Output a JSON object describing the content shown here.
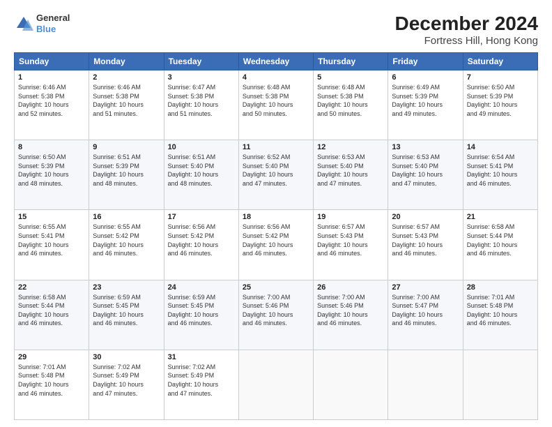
{
  "header": {
    "logo": {
      "line1": "General",
      "line2": "Blue"
    },
    "title": "December 2024",
    "subtitle": "Fortress Hill, Hong Kong"
  },
  "calendar": {
    "days_of_week": [
      "Sunday",
      "Monday",
      "Tuesday",
      "Wednesday",
      "Thursday",
      "Friday",
      "Saturday"
    ],
    "weeks": [
      [
        {
          "day": "",
          "info": ""
        },
        {
          "day": "2",
          "info": "Sunrise: 6:46 AM\nSunset: 5:38 PM\nDaylight: 10 hours\nand 51 minutes."
        },
        {
          "day": "3",
          "info": "Sunrise: 6:47 AM\nSunset: 5:38 PM\nDaylight: 10 hours\nand 51 minutes."
        },
        {
          "day": "4",
          "info": "Sunrise: 6:48 AM\nSunset: 5:38 PM\nDaylight: 10 hours\nand 50 minutes."
        },
        {
          "day": "5",
          "info": "Sunrise: 6:48 AM\nSunset: 5:38 PM\nDaylight: 10 hours\nand 50 minutes."
        },
        {
          "day": "6",
          "info": "Sunrise: 6:49 AM\nSunset: 5:39 PM\nDaylight: 10 hours\nand 49 minutes."
        },
        {
          "day": "7",
          "info": "Sunrise: 6:50 AM\nSunset: 5:39 PM\nDaylight: 10 hours\nand 49 minutes."
        }
      ],
      [
        {
          "day": "1",
          "info": "Sunrise: 6:46 AM\nSunset: 5:38 PM\nDaylight: 10 hours\nand 52 minutes."
        },
        {
          "day": "",
          "info": ""
        },
        {
          "day": "",
          "info": ""
        },
        {
          "day": "",
          "info": ""
        },
        {
          "day": "",
          "info": ""
        },
        {
          "day": "",
          "info": ""
        },
        {
          "day": "",
          "info": ""
        }
      ],
      [
        {
          "day": "8",
          "info": "Sunrise: 6:50 AM\nSunset: 5:39 PM\nDaylight: 10 hours\nand 48 minutes."
        },
        {
          "day": "9",
          "info": "Sunrise: 6:51 AM\nSunset: 5:39 PM\nDaylight: 10 hours\nand 48 minutes."
        },
        {
          "day": "10",
          "info": "Sunrise: 6:51 AM\nSunset: 5:40 PM\nDaylight: 10 hours\nand 48 minutes."
        },
        {
          "day": "11",
          "info": "Sunrise: 6:52 AM\nSunset: 5:40 PM\nDaylight: 10 hours\nand 47 minutes."
        },
        {
          "day": "12",
          "info": "Sunrise: 6:53 AM\nSunset: 5:40 PM\nDaylight: 10 hours\nand 47 minutes."
        },
        {
          "day": "13",
          "info": "Sunrise: 6:53 AM\nSunset: 5:40 PM\nDaylight: 10 hours\nand 47 minutes."
        },
        {
          "day": "14",
          "info": "Sunrise: 6:54 AM\nSunset: 5:41 PM\nDaylight: 10 hours\nand 46 minutes."
        }
      ],
      [
        {
          "day": "15",
          "info": "Sunrise: 6:55 AM\nSunset: 5:41 PM\nDaylight: 10 hours\nand 46 minutes."
        },
        {
          "day": "16",
          "info": "Sunrise: 6:55 AM\nSunset: 5:42 PM\nDaylight: 10 hours\nand 46 minutes."
        },
        {
          "day": "17",
          "info": "Sunrise: 6:56 AM\nSunset: 5:42 PM\nDaylight: 10 hours\nand 46 minutes."
        },
        {
          "day": "18",
          "info": "Sunrise: 6:56 AM\nSunset: 5:42 PM\nDaylight: 10 hours\nand 46 minutes."
        },
        {
          "day": "19",
          "info": "Sunrise: 6:57 AM\nSunset: 5:43 PM\nDaylight: 10 hours\nand 46 minutes."
        },
        {
          "day": "20",
          "info": "Sunrise: 6:57 AM\nSunset: 5:43 PM\nDaylight: 10 hours\nand 46 minutes."
        },
        {
          "day": "21",
          "info": "Sunrise: 6:58 AM\nSunset: 5:44 PM\nDaylight: 10 hours\nand 46 minutes."
        }
      ],
      [
        {
          "day": "22",
          "info": "Sunrise: 6:58 AM\nSunset: 5:44 PM\nDaylight: 10 hours\nand 46 minutes."
        },
        {
          "day": "23",
          "info": "Sunrise: 6:59 AM\nSunset: 5:45 PM\nDaylight: 10 hours\nand 46 minutes."
        },
        {
          "day": "24",
          "info": "Sunrise: 6:59 AM\nSunset: 5:45 PM\nDaylight: 10 hours\nand 46 minutes."
        },
        {
          "day": "25",
          "info": "Sunrise: 7:00 AM\nSunset: 5:46 PM\nDaylight: 10 hours\nand 46 minutes."
        },
        {
          "day": "26",
          "info": "Sunrise: 7:00 AM\nSunset: 5:46 PM\nDaylight: 10 hours\nand 46 minutes."
        },
        {
          "day": "27",
          "info": "Sunrise: 7:00 AM\nSunset: 5:47 PM\nDaylight: 10 hours\nand 46 minutes."
        },
        {
          "day": "28",
          "info": "Sunrise: 7:01 AM\nSunset: 5:48 PM\nDaylight: 10 hours\nand 46 minutes."
        }
      ],
      [
        {
          "day": "29",
          "info": "Sunrise: 7:01 AM\nSunset: 5:48 PM\nDaylight: 10 hours\nand 46 minutes."
        },
        {
          "day": "30",
          "info": "Sunrise: 7:02 AM\nSunset: 5:49 PM\nDaylight: 10 hours\nand 47 minutes."
        },
        {
          "day": "31",
          "info": "Sunrise: 7:02 AM\nSunset: 5:49 PM\nDaylight: 10 hours\nand 47 minutes."
        },
        {
          "day": "",
          "info": ""
        },
        {
          "day": "",
          "info": ""
        },
        {
          "day": "",
          "info": ""
        },
        {
          "day": "",
          "info": ""
        }
      ]
    ]
  }
}
